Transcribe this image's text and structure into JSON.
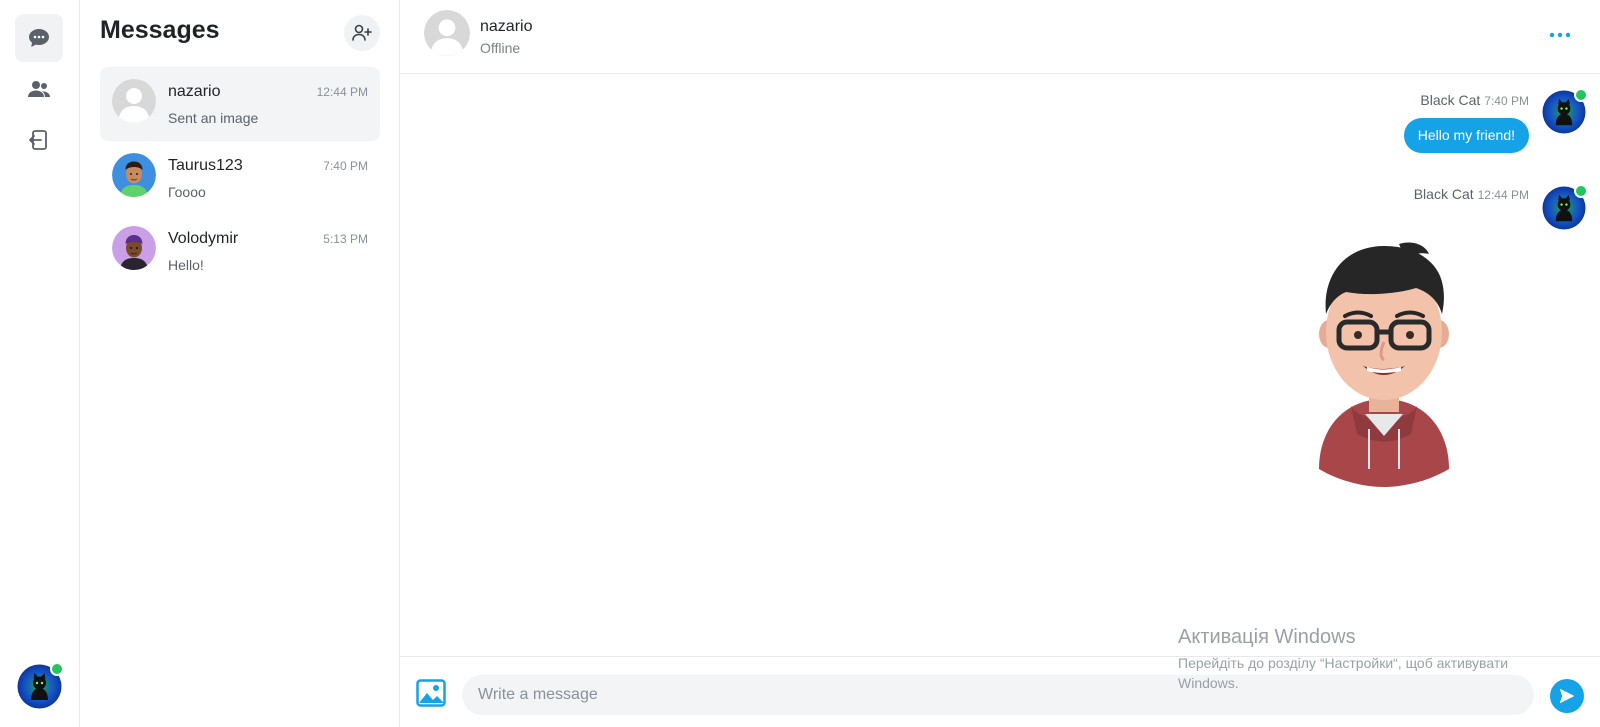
{
  "messages_panel": {
    "title": "Messages",
    "conversations": [
      {
        "name": "nazario",
        "time": "12:44 PM",
        "preview": "Sent an image",
        "active": true
      },
      {
        "name": "Taurus123",
        "time": "7:40 PM",
        "preview": "Гоооо",
        "active": false
      },
      {
        "name": "Volodymir",
        "time": "5:13 PM",
        "preview": "Hello!",
        "active": false
      }
    ]
  },
  "chat": {
    "contact_name": "nazario",
    "contact_status": "Offline",
    "messages": [
      {
        "sender": "Black Cat",
        "time": "7:40 PM",
        "text": "Hello my friend!"
      },
      {
        "sender": "Black Cat",
        "time": "12:44 PM",
        "type": "image"
      }
    ]
  },
  "composer": {
    "placeholder": "Write a message"
  },
  "watermark": {
    "title": "Активація Windows",
    "subtitle": "Перейдіть до розділу “Настройки“, щоб активувати Windows."
  },
  "colors": {
    "accent": "#16a2e6",
    "online": "#22c55e"
  }
}
